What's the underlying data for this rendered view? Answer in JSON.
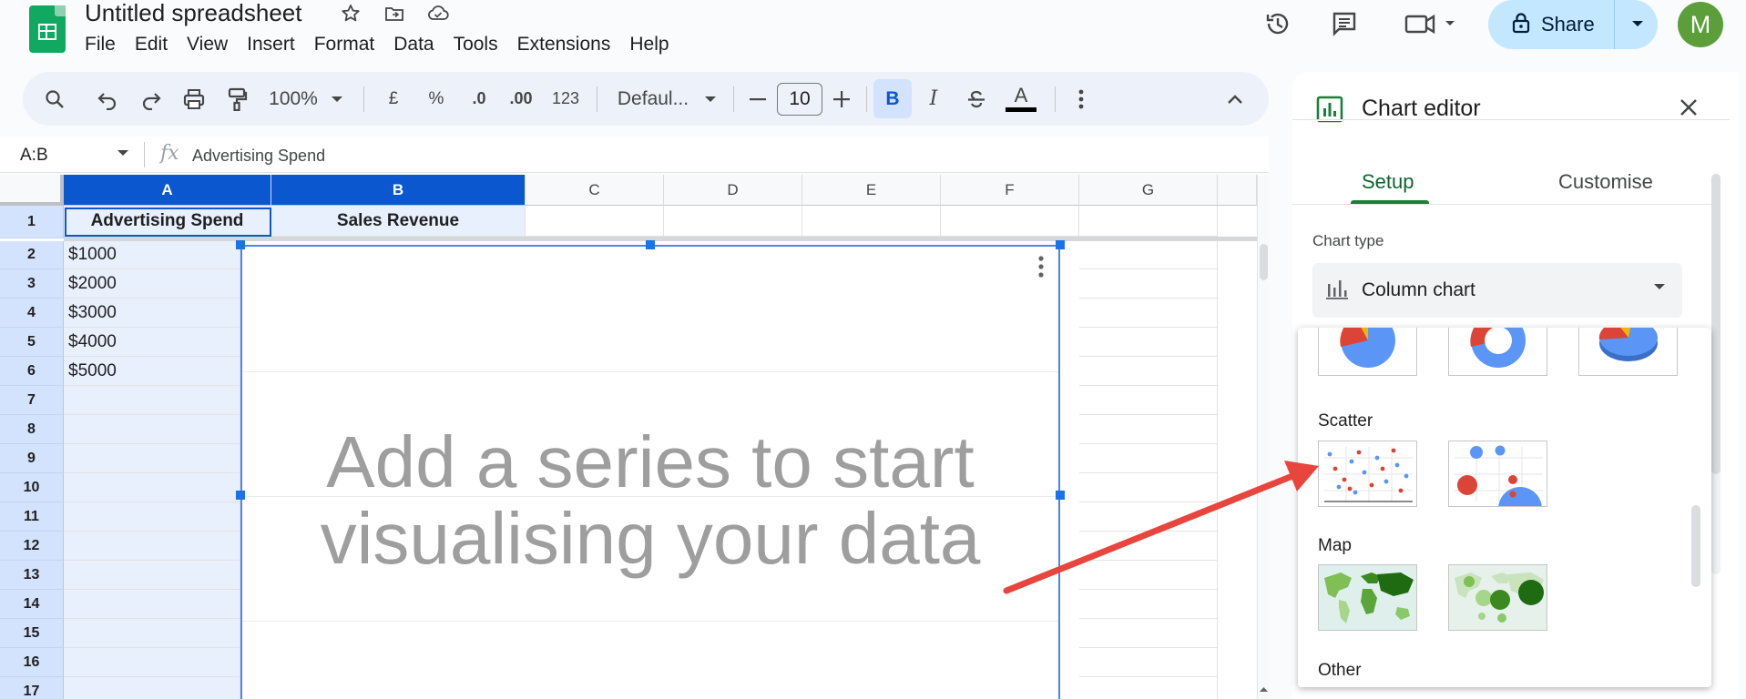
{
  "title_bar": {
    "doc_title": "Untitled spreadsheet",
    "share_label": "Share",
    "avatar_letter": "M"
  },
  "menu": [
    "File",
    "Edit",
    "View",
    "Insert",
    "Format",
    "Data",
    "Tools",
    "Extensions",
    "Help"
  ],
  "toolbar": {
    "zoom": "100%",
    "currency": "£",
    "percent": "%",
    "decrease_decimal": ".0",
    "increase_decimal": ".00",
    "number_format": "123",
    "font": "Defaul...",
    "font_size": "10",
    "bold": "B",
    "italic": "I",
    "text_color": "A"
  },
  "formula_bar": {
    "name_box": "A:B",
    "fx": "fx",
    "content": "Advertising Spend"
  },
  "sheet": {
    "columns": [
      "A",
      "B",
      "C",
      "D",
      "E",
      "F",
      "G"
    ],
    "rows": [
      "1",
      "2",
      "3",
      "4",
      "5",
      "6",
      "7",
      "8",
      "9",
      "10",
      "11",
      "12",
      "13",
      "14",
      "15",
      "16",
      "17"
    ],
    "header_a": "Advertising Spend",
    "header_b": "Sales Revenue",
    "values_a": [
      "$1000",
      "$2000",
      "$3000",
      "$4000",
      "$5000"
    ]
  },
  "chart": {
    "message_line1": "Add a series to start",
    "message_line2": "visualising your data"
  },
  "editor": {
    "title": "Chart editor",
    "tabs": [
      "Setup",
      "Customise"
    ],
    "chart_type_label": "Chart type",
    "chart_type_value": "Column chart",
    "sections": [
      "Scatter",
      "Map",
      "Other"
    ]
  },
  "colors": {
    "sheets_green": "#11a861",
    "selection_blue": "#0b57d0",
    "share_bg": "#c2e7ff",
    "annotation_red": "#e8453c",
    "chart_blue": "#5b95f5",
    "chart_red": "#db4437",
    "chart_yellow": "#f4b400"
  }
}
